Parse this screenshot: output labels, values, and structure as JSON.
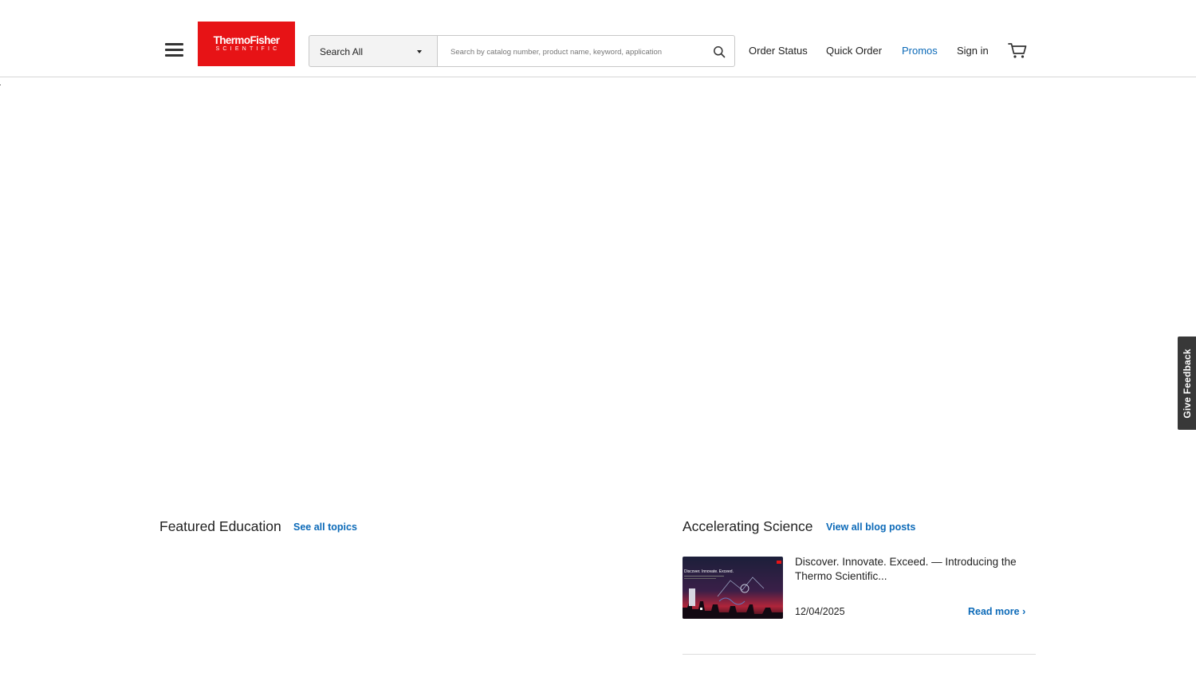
{
  "header": {
    "menu_icon": "hamburger-menu-icon",
    "logo": {
      "line1": "ThermoFisher",
      "line2": "SCIENTIFIC",
      "color": "#e71316"
    },
    "search": {
      "scope_label": "Search All",
      "placeholder": "Search by catalog number, product name, keyword, application",
      "value": "",
      "icon": "search-icon"
    },
    "nav": {
      "order_status": "Order Status",
      "quick_order": "Quick Order",
      "promos": "Promos",
      "sign_in": "Sign in"
    },
    "cart_icon": "cart-icon"
  },
  "feedback_tab": {
    "label": "Give Feedback"
  },
  "featured_education": {
    "title": "Featured Education",
    "link": "See all topics"
  },
  "accelerating_science": {
    "title": "Accelerating Science",
    "link": "View all blog posts",
    "posts": [
      {
        "thumbnail_text": "Discover. Innovate. Exceed.",
        "title": "Discover. Innovate. Exceed. — Introducing the Thermo Scientific...",
        "date": "12/04/2025",
        "read_more": "Read more ›"
      }
    ]
  },
  "colors": {
    "brand_red": "#e71316",
    "link_blue": "#0c6ab8",
    "text": "#222222",
    "feedback_bg": "#383838"
  }
}
